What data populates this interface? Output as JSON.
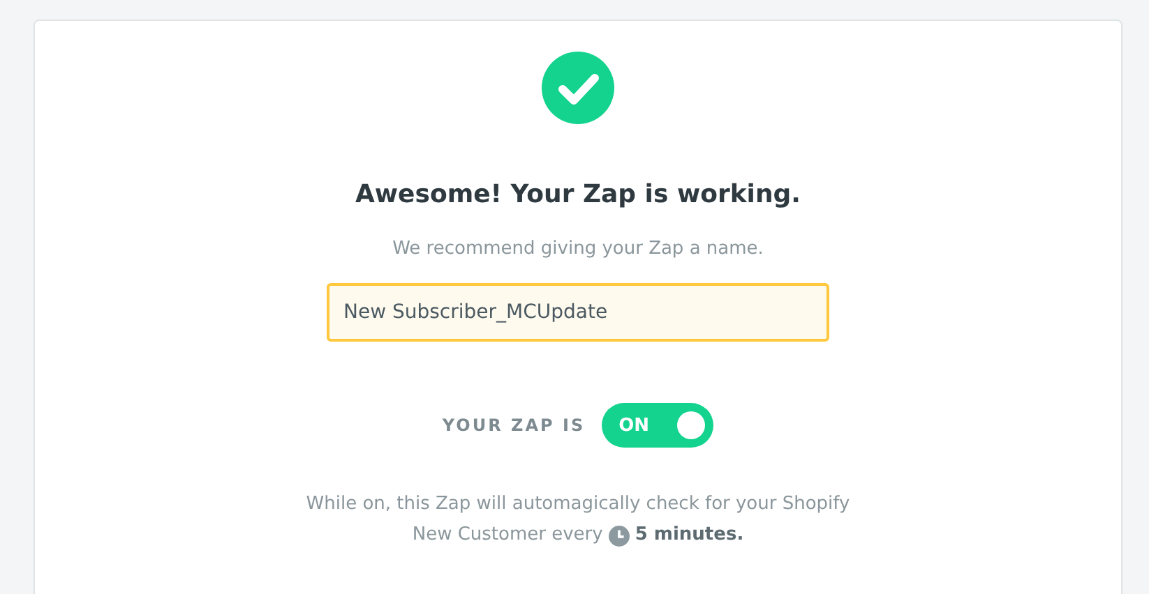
{
  "heading": "Awesome! Your Zap is working.",
  "subtitle": "We recommend giving your Zap a name.",
  "name_field": {
    "value": "New Subscriber_MCUpdate",
    "focused": true
  },
  "toggle": {
    "label": "YOUR ZAP IS",
    "text": "ON",
    "on": true
  },
  "description": {
    "line_1": "While on, this Zap will automagically check for your Shopify",
    "line_2": "New Customer every",
    "interval": "5 minutes."
  }
}
